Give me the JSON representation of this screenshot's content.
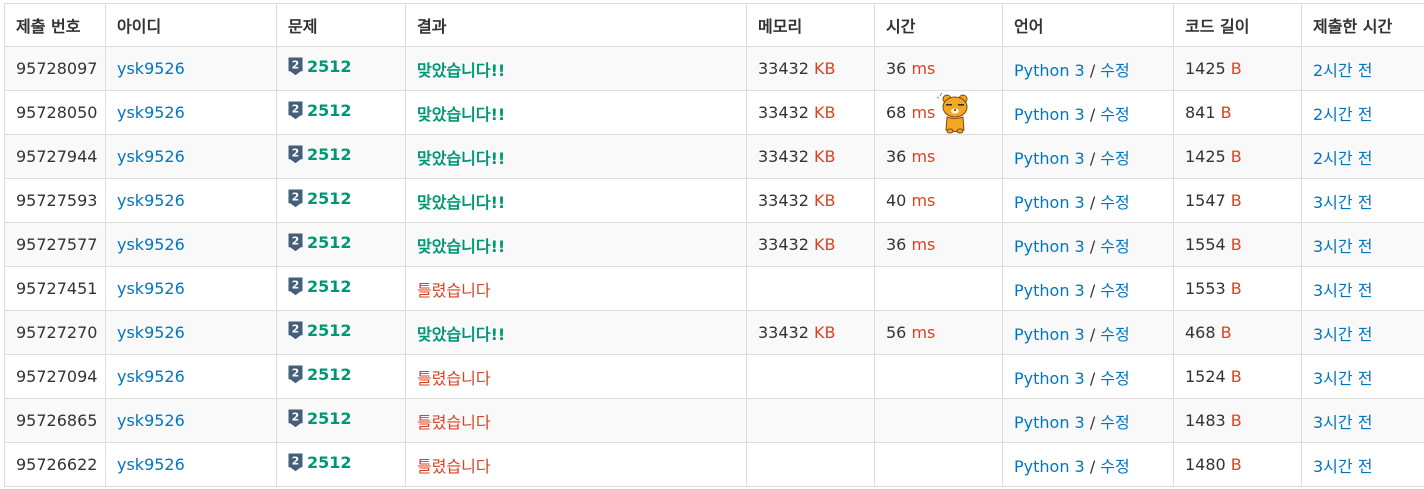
{
  "headers": [
    "제출 번호",
    "아이디",
    "문제",
    "결과",
    "메모리",
    "시간",
    "언어",
    "코드 길이",
    "제출한 시간"
  ],
  "units": {
    "memory": "KB",
    "time": "ms",
    "code": "B"
  },
  "colors": {
    "link": "#0076c0",
    "accepted": "#009874",
    "wrong": "#dd4124",
    "tier_badge": "#435f7a"
  },
  "icons": {
    "tier": "silver-2-tier-icon",
    "emoticon": "ryan-bear-emoticon"
  },
  "rows": [
    {
      "id": "95728097",
      "user": "ysk9526",
      "tier": "2",
      "problem": "2512",
      "result": "맞았습니다!!",
      "status": "accepted",
      "memory": "33432",
      "time": "36",
      "lang": "Python 3",
      "edit": "수정",
      "code": "1425",
      "when": "2시간 전"
    },
    {
      "id": "95728050",
      "user": "ysk9526",
      "tier": "2",
      "problem": "2512",
      "result": "맞았습니다!!",
      "status": "accepted",
      "memory": "33432",
      "time": "68",
      "lang": "Python 3",
      "edit": "수정",
      "code": "841",
      "when": "2시간 전",
      "emoticon": true
    },
    {
      "id": "95727944",
      "user": "ysk9526",
      "tier": "2",
      "problem": "2512",
      "result": "맞았습니다!!",
      "status": "accepted",
      "memory": "33432",
      "time": "36",
      "lang": "Python 3",
      "edit": "수정",
      "code": "1425",
      "when": "2시간 전"
    },
    {
      "id": "95727593",
      "user": "ysk9526",
      "tier": "2",
      "problem": "2512",
      "result": "맞았습니다!!",
      "status": "accepted",
      "memory": "33432",
      "time": "40",
      "lang": "Python 3",
      "edit": "수정",
      "code": "1547",
      "when": "3시간 전"
    },
    {
      "id": "95727577",
      "user": "ysk9526",
      "tier": "2",
      "problem": "2512",
      "result": "맞았습니다!!",
      "status": "accepted",
      "memory": "33432",
      "time": "36",
      "lang": "Python 3",
      "edit": "수정",
      "code": "1554",
      "when": "3시간 전"
    },
    {
      "id": "95727451",
      "user": "ysk9526",
      "tier": "2",
      "problem": "2512",
      "result": "틀렸습니다",
      "status": "wrong",
      "memory": "",
      "time": "",
      "lang": "Python 3",
      "edit": "수정",
      "code": "1553",
      "when": "3시간 전"
    },
    {
      "id": "95727270",
      "user": "ysk9526",
      "tier": "2",
      "problem": "2512",
      "result": "맞았습니다!!",
      "status": "accepted",
      "memory": "33432",
      "time": "56",
      "lang": "Python 3",
      "edit": "수정",
      "code": "468",
      "when": "3시간 전"
    },
    {
      "id": "95727094",
      "user": "ysk9526",
      "tier": "2",
      "problem": "2512",
      "result": "틀렸습니다",
      "status": "wrong",
      "memory": "",
      "time": "",
      "lang": "Python 3",
      "edit": "수정",
      "code": "1524",
      "when": "3시간 전"
    },
    {
      "id": "95726865",
      "user": "ysk9526",
      "tier": "2",
      "problem": "2512",
      "result": "틀렸습니다",
      "status": "wrong",
      "memory": "",
      "time": "",
      "lang": "Python 3",
      "edit": "수정",
      "code": "1483",
      "when": "3시간 전"
    },
    {
      "id": "95726622",
      "user": "ysk9526",
      "tier": "2",
      "problem": "2512",
      "result": "틀렸습니다",
      "status": "wrong",
      "memory": "",
      "time": "",
      "lang": "Python 3",
      "edit": "수정",
      "code": "1480",
      "when": "3시간 전"
    }
  ]
}
